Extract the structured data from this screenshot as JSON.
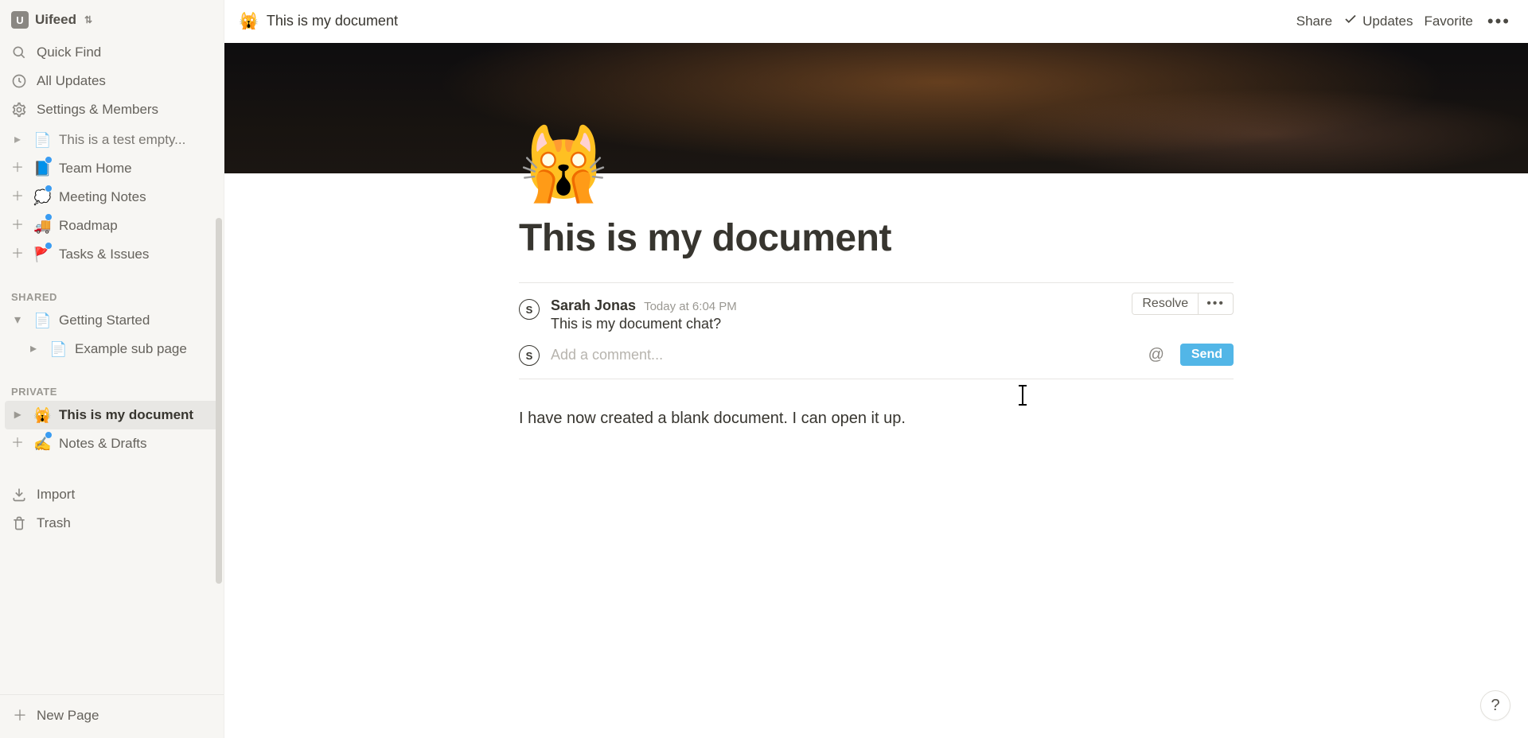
{
  "workspace": {
    "name": "Uifeed",
    "avatar_initial": "U"
  },
  "sidebar": {
    "nav": {
      "quick_find": "Quick Find",
      "all_updates": "All Updates",
      "settings": "Settings & Members"
    },
    "pages_top": [
      {
        "emoji": "📄",
        "label": "This is a test empty...",
        "add": false,
        "cut": true,
        "dot": false
      },
      {
        "emoji": "📘",
        "label": "Team Home",
        "add": true,
        "dot": true
      },
      {
        "emoji": "💭",
        "label": "Meeting Notes",
        "add": true,
        "dot": true
      },
      {
        "emoji": "🚚",
        "label": "Roadmap",
        "add": true,
        "dot": true
      },
      {
        "emoji": "🚩",
        "label": "Tasks & Issues",
        "add": true,
        "dot": true
      }
    ],
    "shared_label": "SHARED",
    "shared": [
      {
        "emoji": "📄",
        "label": "Getting Started",
        "expanded": true,
        "toggle": "▾",
        "children": [
          {
            "emoji": "📄",
            "label": "Example sub page"
          }
        ]
      }
    ],
    "private_label": "PRIVATE",
    "private": [
      {
        "emoji": "🙀",
        "label": "This is my document",
        "active": true,
        "toggle": "▸"
      },
      {
        "emoji": "✍️",
        "label": "Notes & Drafts",
        "add": true,
        "dot": true
      }
    ],
    "footer": {
      "import": "Import",
      "trash": "Trash",
      "new_page": "New Page"
    }
  },
  "topbar": {
    "breadcrumb_emoji": "🙀",
    "breadcrumb_title": "This is my document",
    "share": "Share",
    "updates": "Updates",
    "favorite": "Favorite"
  },
  "page": {
    "emoji": "🙀",
    "title": "This is my document",
    "body_paragraph": "I have now created a blank document. I can open it up."
  },
  "comments": {
    "resolve_label": "Resolve",
    "items": [
      {
        "avatar_initial": "S",
        "author": "Sarah Jonas",
        "time": "Today at 6:04 PM",
        "text": "This is my document chat?"
      }
    ],
    "input": {
      "avatar_initial": "S",
      "placeholder": "Add a comment..."
    },
    "send_label": "Send"
  },
  "help_label": "?"
}
